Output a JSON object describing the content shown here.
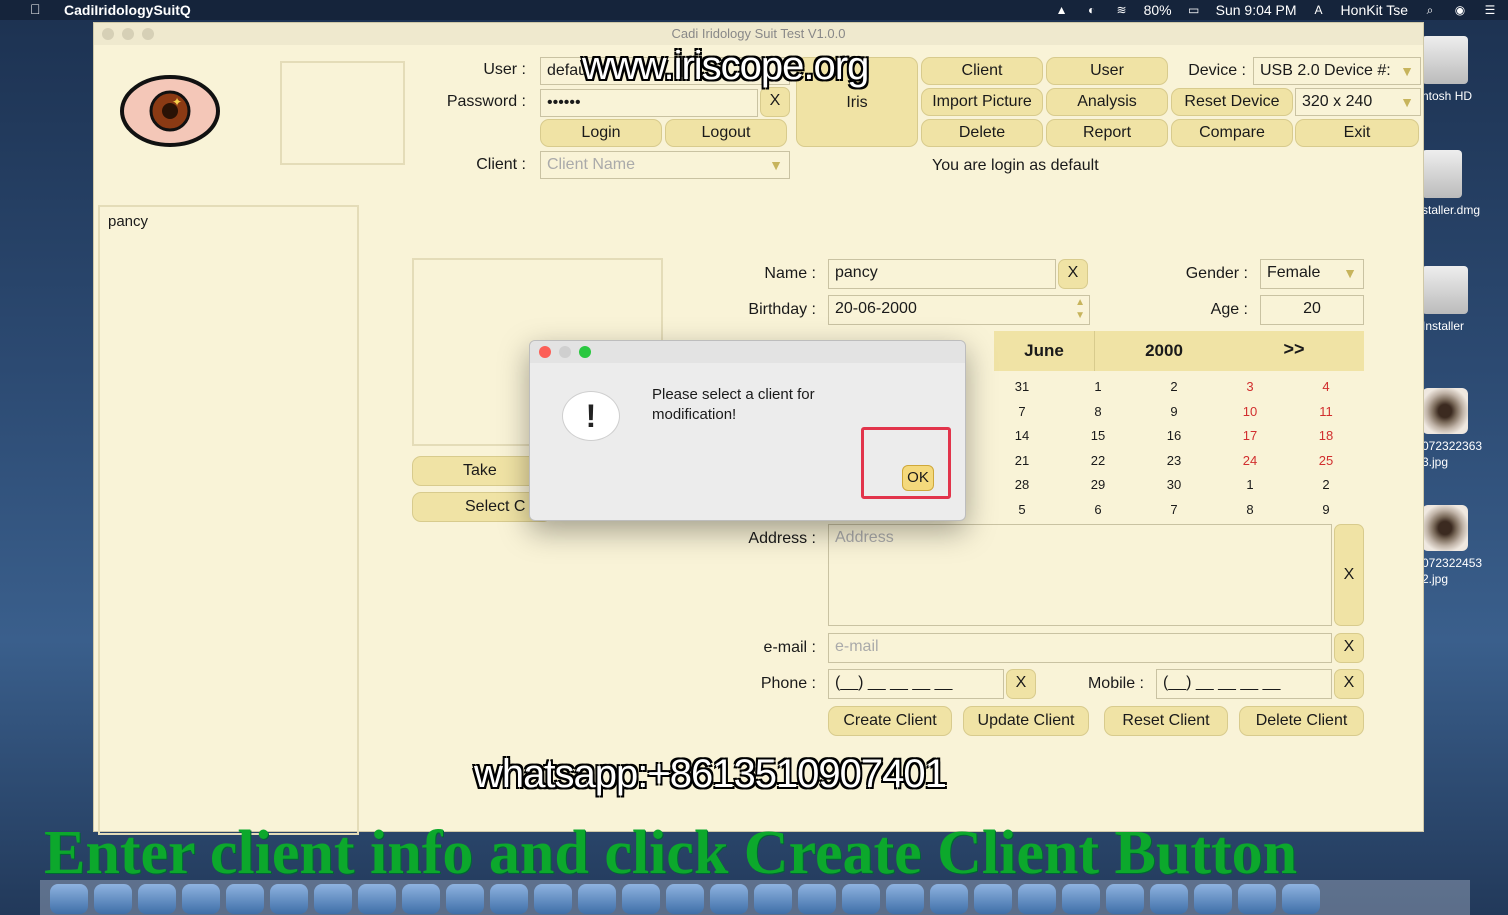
{
  "menubar": {
    "app_name": "CadiIridologySuitQ",
    "battery": "80%",
    "clock": "Sun 9:04 PM",
    "user": "HonKit Tse"
  },
  "desktop_icons": [
    {
      "label": "ntosh HD"
    },
    {
      "label": "staller.dmg"
    },
    {
      "label": "Installer"
    },
    {
      "label": "072322363\n3.jpg"
    },
    {
      "label": "072322453\n2.jpg"
    }
  ],
  "window": {
    "title": "Cadi Iridology Suit Test V1.0.0",
    "login": {
      "user_label": "User :",
      "user_value": "defau",
      "password_label": "Password :",
      "password_value": "••••••",
      "clear": "X",
      "login_btn": "Login",
      "logout_btn": "Logout",
      "client_label": "Client :",
      "client_placeholder": "Client Name",
      "status": "You are login as default"
    },
    "toolbar": {
      "iris": "Iris",
      "client": "Client",
      "user": "User",
      "import_picture": "Import Picture",
      "analysis": "Analysis",
      "delete": "Delete",
      "report": "Report",
      "compare": "Compare",
      "exit": "Exit",
      "reset_device": "Reset Device",
      "device_label": "Device :",
      "device_value": "USB 2.0 Device #:",
      "resolution": "320 x 240"
    },
    "client_list": [
      "pancy"
    ],
    "photo_buttons": {
      "take": "Take",
      "select": "Select C"
    },
    "form": {
      "name_label": "Name :",
      "name_value": "pancy",
      "birthday_label": "Birthday :",
      "birthday_value": "20-06-2000",
      "gender_label": "Gender :",
      "gender_value": "Female",
      "age_label": "Age :",
      "age_value": "20",
      "address_label": "Address :",
      "address_placeholder": "Address",
      "email_label": "e-mail :",
      "email_placeholder": "e-mail",
      "phone_label": "Phone :",
      "phone_placeholder": "(__) __ __ __ __",
      "mobile_label": "Mobile :",
      "mobile_placeholder": "(__) __ __ __ __",
      "x": "X",
      "create": "Create Client",
      "update": "Update Client",
      "reset": "Reset Client",
      "delete": "Delete Client"
    },
    "calendar": {
      "month": "June",
      "year": "2000",
      "next": ">>",
      "rows": [
        [
          "31",
          "1",
          "2",
          "3",
          "4"
        ],
        [
          "7",
          "8",
          "9",
          "10",
          "11"
        ],
        [
          "14",
          "15",
          "16",
          "17",
          "18"
        ],
        [
          "21",
          "22",
          "23",
          "24",
          "25"
        ],
        [
          "28",
          "29",
          "30",
          "1",
          "2"
        ],
        [
          "5",
          "6",
          "7",
          "8",
          "9"
        ]
      ]
    }
  },
  "dialog": {
    "icon": "!",
    "message": "Please select a client for modification!",
    "ok": "OK"
  },
  "overlays": {
    "site": "www.iriscope.org",
    "whatsapp": "whatsapp:+8613510907401",
    "caption": "Enter client info and click Create Client Button"
  },
  "colors": {
    "window_bg": "#f9f3d7",
    "button_bg": "#f0e3a5",
    "caption_green": "#0ca82c",
    "highlight_red": "#e2344b"
  }
}
